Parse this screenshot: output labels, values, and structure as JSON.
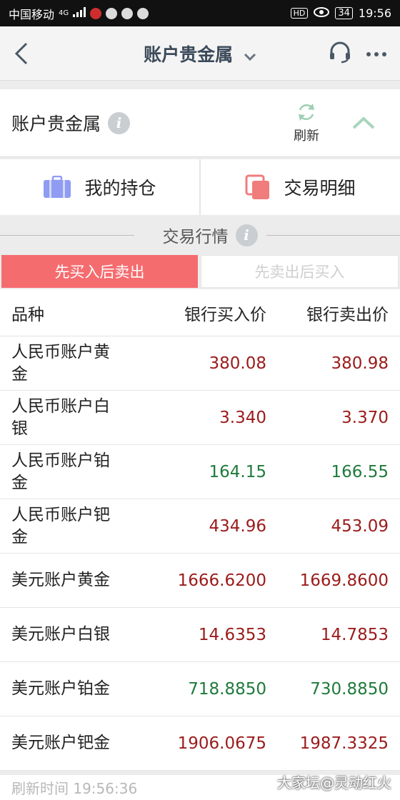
{
  "statusbar": {
    "carrier": "中国移动",
    "network": "4G",
    "time": "19:56",
    "battery": "34",
    "hd": "HD"
  },
  "nav": {
    "title": "账户贵金属"
  },
  "section": {
    "title": "账户贵金属",
    "info": "i",
    "refresh_label": "刷新"
  },
  "tabs": {
    "holdings": "我的持仓",
    "details": "交易明细"
  },
  "market": {
    "title": "交易行情",
    "info": "i"
  },
  "toggle": {
    "buy_first": "先买入后卖出",
    "sell_first": "先卖出后买入",
    "active": "buy_first"
  },
  "table": {
    "headers": {
      "name": "品种",
      "bank_buy": "银行买入价",
      "bank_sell": "银行卖出价"
    },
    "rows": [
      {
        "name_line1": "人民币账户黄",
        "name_line2": "金",
        "buy": "380.08",
        "sell": "380.98",
        "color": "red"
      },
      {
        "name_line1": "人民币账户白",
        "name_line2": "银",
        "buy": "3.340",
        "sell": "3.370",
        "color": "red"
      },
      {
        "name_line1": "人民币账户铂",
        "name_line2": "金",
        "buy": "164.15",
        "sell": "166.55",
        "color": "green"
      },
      {
        "name_line1": "人民币账户钯",
        "name_line2": "金",
        "buy": "434.96",
        "sell": "453.09",
        "color": "red"
      },
      {
        "name_line1": "美元账户黄金",
        "name_line2": "",
        "buy": "1666.6200",
        "sell": "1669.8600",
        "color": "red"
      },
      {
        "name_line1": "美元账户白银",
        "name_line2": "",
        "buy": "14.6353",
        "sell": "14.7853",
        "color": "red"
      },
      {
        "name_line1": "美元账户铂金",
        "name_line2": "",
        "buy": "718.8850",
        "sell": "730.8850",
        "color": "green"
      },
      {
        "name_line1": "美元账户钯金",
        "name_line2": "",
        "buy": "1906.0675",
        "sell": "1987.3325",
        "color": "red"
      }
    ]
  },
  "footer": {
    "refresh_time": "刷新时间 19:56:36"
  },
  "watermark": "大家坛@灵动红火",
  "colors": {
    "up": "#9b1b1b",
    "down": "#1f7a3c",
    "accent": "#f56c6f",
    "title": "#3c4a5a"
  }
}
